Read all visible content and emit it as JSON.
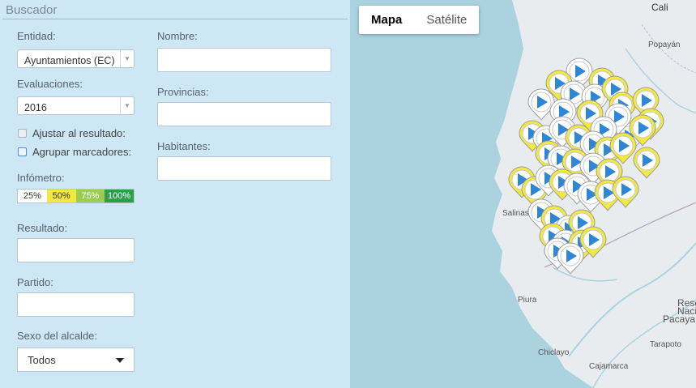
{
  "panel": {
    "title": "Buscador",
    "entidad": {
      "label": "Entidad:",
      "value": "Ayuntamientos (EC)"
    },
    "evaluaciones": {
      "label": "Evaluaciones:",
      "value": "2016"
    },
    "ajustar": {
      "label": "Ajustar al resultado:",
      "checked": false
    },
    "agrupar": {
      "label": "Agrupar marcadores:",
      "checked": false
    },
    "infometro": {
      "label": "Infómetro:",
      "segments": [
        {
          "label": "25%",
          "color": "#ffffff",
          "text_color": "#333333"
        },
        {
          "label": "50%",
          "color": "#f1ea3c",
          "text_color": "#333333"
        },
        {
          "label": "75%",
          "color": "#9acd51",
          "text_color": "#ffffff"
        },
        {
          "label": "100%",
          "color": "#27a14a",
          "text_color": "#ffffff"
        }
      ]
    },
    "resultado": {
      "label": "Resultado:",
      "value": ""
    },
    "partido": {
      "label": "Partido:",
      "value": ""
    },
    "sexo": {
      "label": "Sexo del alcalde:",
      "value": "Todos"
    },
    "nombre": {
      "label": "Nombre:",
      "value": ""
    },
    "provincias": {
      "label": "Provincias:",
      "value": ""
    },
    "habitantes": {
      "label": "Habitantes:",
      "value": ""
    }
  },
  "map": {
    "map_type_buttons": [
      "Mapa",
      "Satélite"
    ],
    "active_map_type": "Mapa",
    "city_labels": [
      "Cali",
      "Popayán",
      "Salinas",
      "Piura",
      "Chiclayo",
      "Cajamarca",
      "Tarapoto",
      "Pacaya",
      "Rese",
      "Naci"
    ],
    "marker_icon": "play-triangle-pin-icon",
    "marker_fill_color": "#2e86d6",
    "marker_ring_color": "#f1ea3c"
  }
}
